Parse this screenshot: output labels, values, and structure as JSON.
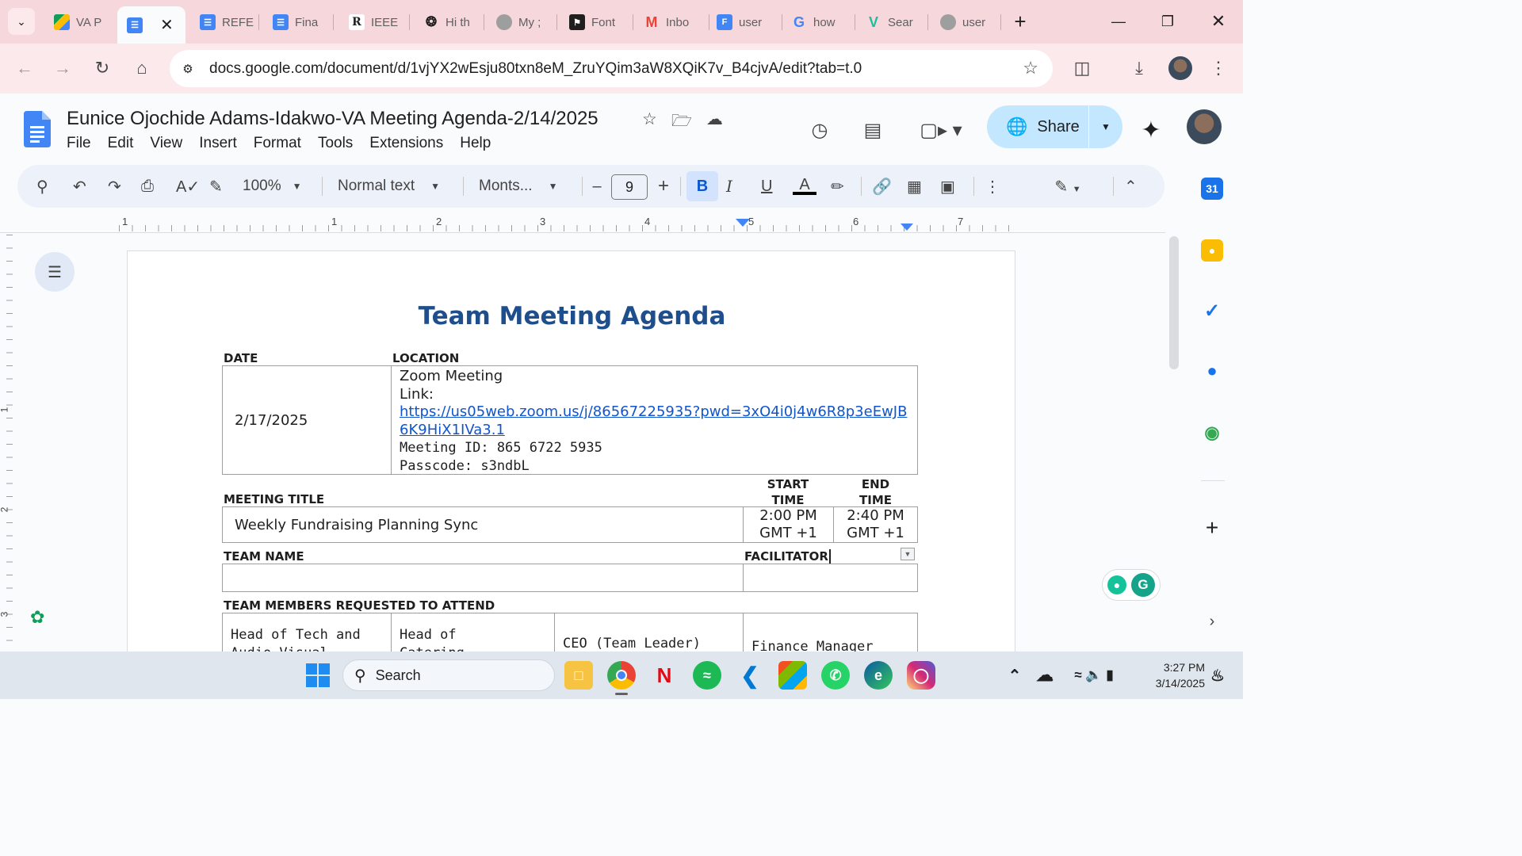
{
  "browser": {
    "tabs": [
      {
        "label": "VA P",
        "icon": "google-drive-icon",
        "color": "#1a73e8"
      },
      {
        "label": "",
        "icon": "google-docs-icon",
        "color": "#4285f4",
        "active": true
      },
      {
        "label": "REFE",
        "icon": "google-docs-icon",
        "color": "#4285f4"
      },
      {
        "label": "Fina",
        "icon": "google-docs-icon",
        "color": "#4285f4"
      },
      {
        "label": "IEEE",
        "icon": "researchgate-icon",
        "color": "#1f1f1f"
      },
      {
        "label": "Hi th",
        "icon": "chatgpt-icon",
        "color": "#1f1f1f"
      },
      {
        "label": "My ;",
        "icon": "globe-icon",
        "color": "#8a8a8a"
      },
      {
        "label": "Font",
        "icon": "font-site-icon",
        "color": "#1f1f1f"
      },
      {
        "label": "Inbo",
        "icon": "gmail-icon",
        "color": "#ea4335"
      },
      {
        "label": "user",
        "icon": "google-forms-icon",
        "color": "#4285f4"
      },
      {
        "label": "how",
        "icon": "google-icon",
        "color": "#4285f4"
      },
      {
        "label": "Sear",
        "icon": "vuetify-icon",
        "color": "#1dbf9a"
      },
      {
        "label": "user",
        "icon": "globe-icon",
        "color": "#8a8a8a"
      }
    ],
    "url": "docs.google.com/document/d/1vjYX2wEsju80txn8eM_ZruYQim3aW8XQiK7v_B4cjvA/edit?tab=t.0"
  },
  "doc": {
    "title": "Eunice Ojochide Adams-Idakwo-VA Meeting Agenda-2/14/2025",
    "menu": [
      "File",
      "Edit",
      "View",
      "Insert",
      "Format",
      "Tools",
      "Extensions",
      "Help"
    ],
    "share_label": "Share"
  },
  "toolbar": {
    "zoom": "100%",
    "style": "Normal text",
    "font": "Monts...",
    "font_size": "9",
    "bold": "B",
    "italic": "I",
    "underline": "U",
    "text_color": "A"
  },
  "ruler": {
    "h_numbers": [
      "1",
      "1",
      "2",
      "3",
      "4",
      "5",
      "6",
      "7"
    ],
    "v_numbers": [
      "1",
      "2",
      "3"
    ]
  },
  "agenda": {
    "heading": "Team Meeting Agenda",
    "date_label": "DATE",
    "location_label": "LOCATION",
    "date_value": "2/17/2025",
    "location_line1": "Zoom Meeting",
    "location_line2": "Link:",
    "link_line1": "https://us05web.zoom.us/j/86567225935?pwd=3xO4i0j4w6R8p3eEwJB",
    "link_line2": "6K9HiX1IVa3.1",
    "meeting_id": "Meeting ID: 865 6722 5935",
    "passcode": "Passcode: s3ndbL",
    "meeting_title_label": "MEETING TITLE",
    "start_time_label_1": "START",
    "start_time_label_2": "TIME",
    "end_time_label_1": "END",
    "end_time_label_2": "TIME",
    "meeting_title_value": "Weekly Fundraising Planning Sync",
    "start_time_1": "2:00 PM",
    "start_time_2": "GMT +1",
    "end_time_1": "2:40 PM",
    "end_time_2": "GMT +1",
    "team_name_label": "TEAM NAME",
    "facilitator_label": "FACILITATOR",
    "members_label": "TEAM MEMBERS REQUESTED TO ATTEND",
    "member_1a": "Head of Tech and",
    "member_1b": "Audio-Visual",
    "member_2a": "Head of",
    "member_2b": "Catering",
    "member_3": "CEO (Team Leader)",
    "member_4": "Finance Manager"
  },
  "taskbar": {
    "search_label": "Search",
    "time": "3:27 PM",
    "date": "3/14/2025"
  },
  "colors": {
    "tabstrip": "#f6d7dc",
    "accent_blue": "#0b57d0",
    "heading_blue": "#1e4e8c",
    "share_bg": "#c2e7ff"
  }
}
